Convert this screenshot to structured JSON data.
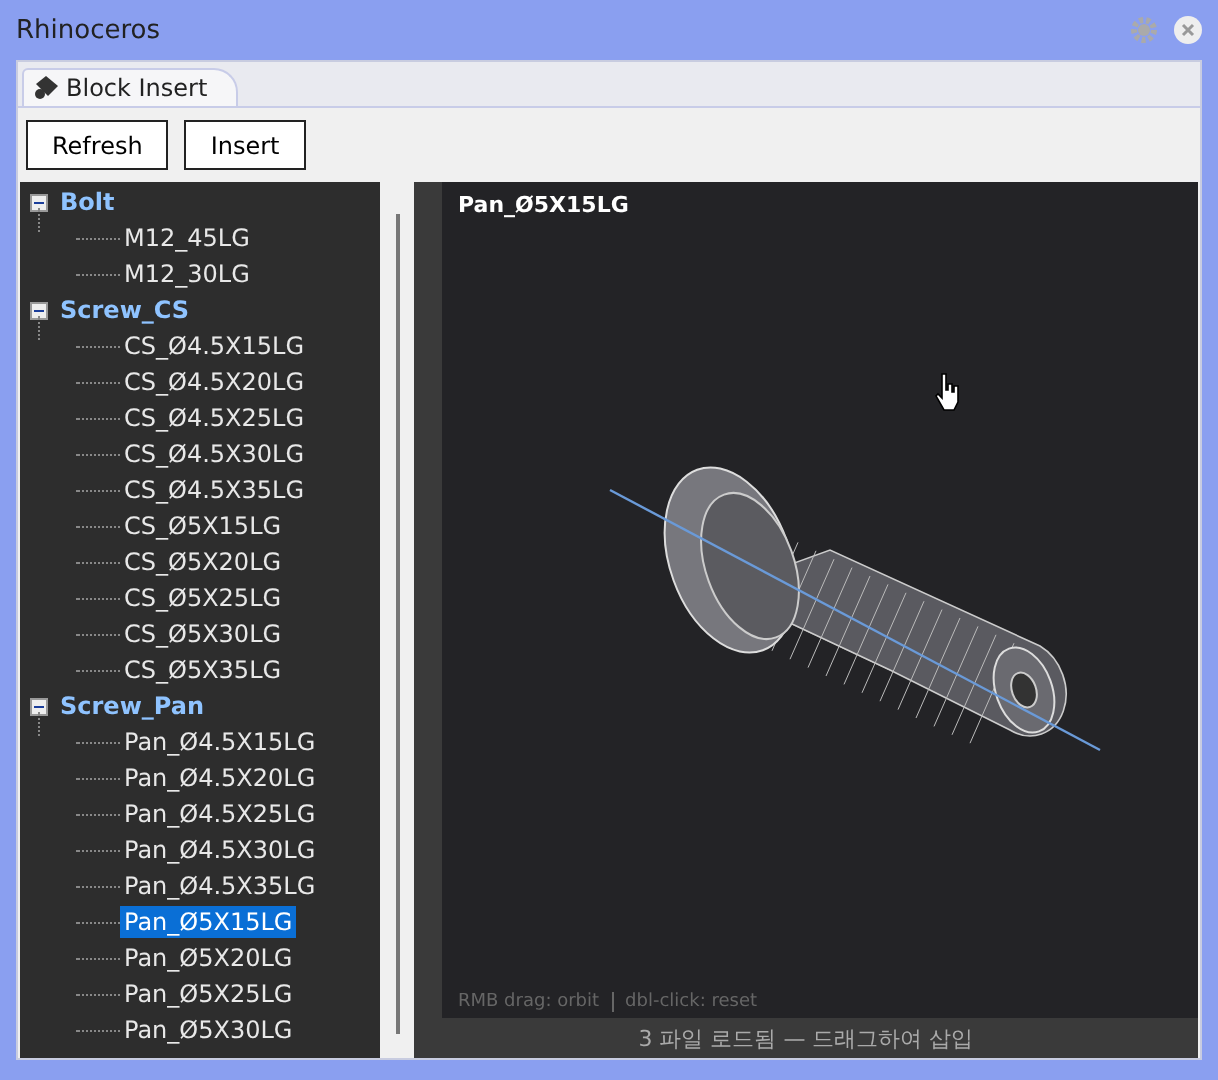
{
  "window": {
    "title": "Rhinoceros"
  },
  "tabs": [
    {
      "label": "Block Insert",
      "selected": true
    }
  ],
  "buttons": [
    "Refresh",
    "Insert"
  ],
  "tree": [
    {
      "label": "Bolt",
      "expanded": true,
      "children": [
        {
          "label": "M12_45LG",
          "selected": false
        },
        {
          "label": "M12_30LG",
          "selected": false
        }
      ]
    },
    {
      "label": "Screw_CS",
      "expanded": true,
      "children": [
        {
          "label": "CS_Ø4.5X15LG",
          "selected": false
        },
        {
          "label": "CS_Ø4.5X20LG",
          "selected": false
        },
        {
          "label": "CS_Ø4.5X25LG",
          "selected": false
        },
        {
          "label": "CS_Ø4.5X30LG",
          "selected": false
        },
        {
          "label": "CS_Ø4.5X35LG",
          "selected": false
        },
        {
          "label": "CS_Ø5X15LG",
          "selected": false
        },
        {
          "label": "CS_Ø5X20LG",
          "selected": false
        },
        {
          "label": "CS_Ø5X25LG",
          "selected": false
        },
        {
          "label": "CS_Ø5X30LG",
          "selected": false
        },
        {
          "label": "CS_Ø5X35LG",
          "selected": false
        }
      ]
    },
    {
      "label": "Screw_Pan",
      "expanded": true,
      "children": [
        {
          "label": "Pan_Ø4.5X15LG",
          "selected": false
        },
        {
          "label": "Pan_Ø4.5X20LG",
          "selected": false
        },
        {
          "label": "Pan_Ø4.5X25LG",
          "selected": false
        },
        {
          "label": "Pan_Ø4.5X30LG",
          "selected": false
        },
        {
          "label": "Pan_Ø4.5X35LG",
          "selected": false
        },
        {
          "label": "Pan_Ø5X15LG",
          "selected": true
        },
        {
          "label": "Pan_Ø5X20LG",
          "selected": false
        },
        {
          "label": "Pan_Ø5X25LG",
          "selected": false
        },
        {
          "label": "Pan_Ø5X30LG",
          "selected": false
        }
      ]
    }
  ],
  "viewport": {
    "title": "Pan_Ø5X15LG",
    "hint": "RMB drag: orbit",
    "hint_2": "dbl-click: reset"
  },
  "status_bar": "3 파일 로드됨 — 드래그하여 삽입"
}
